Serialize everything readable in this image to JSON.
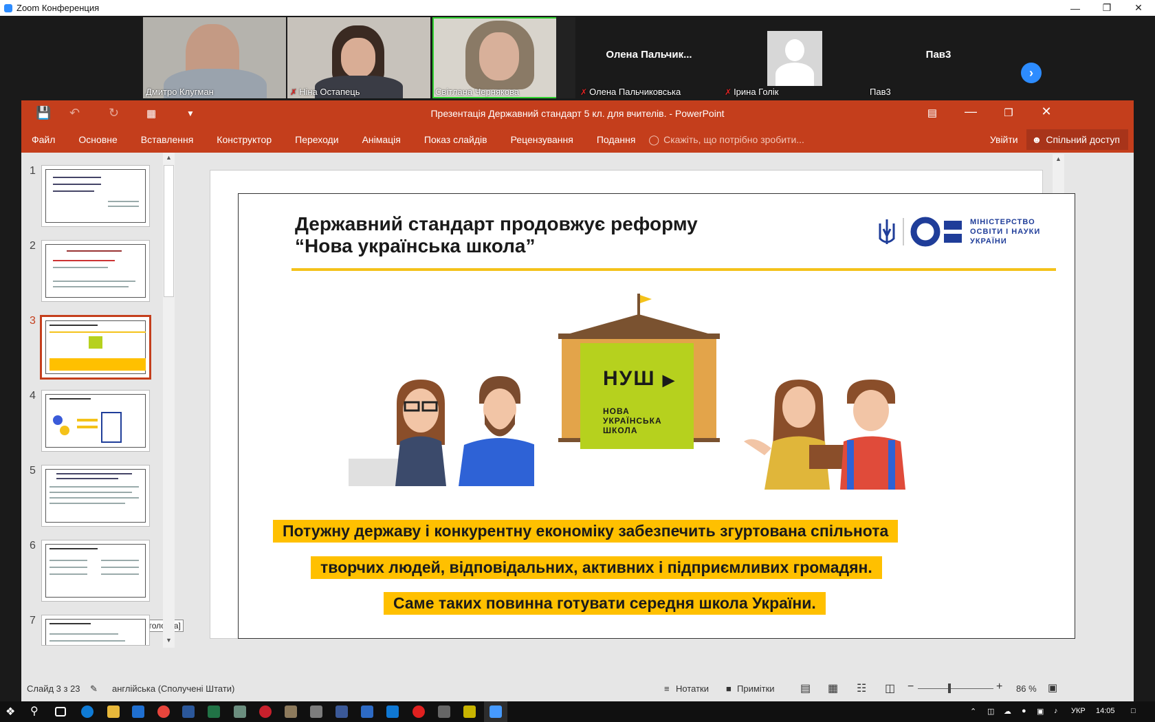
{
  "zoom": {
    "title": "Zoom Конференция",
    "participants": [
      {
        "name": "Дмитро Клугман",
        "muted": false,
        "video": true
      },
      {
        "name": "Ніна Остапець",
        "muted": true,
        "video": true
      },
      {
        "name": "Світлана Чернякова",
        "muted": false,
        "video": true,
        "active": true
      },
      {
        "name": "Олена Пальчиковська",
        "display": "Олена  Пальчик...",
        "muted": true,
        "video": false
      },
      {
        "name": "Ірина Голік",
        "muted": true,
        "video": false
      },
      {
        "name": "Пав3",
        "display": "Пав3",
        "muted": false,
        "video": false
      }
    ]
  },
  "powerpoint": {
    "doc_title": "Презентація Державний стандарт 5 кл. для вчителів. - PowerPoint",
    "tabs": [
      "Файл",
      "Основне",
      "Вставлення",
      "Конструктор",
      "Переходи",
      "Анімація",
      "Показ слайдів",
      "Рецензування",
      "Подання"
    ],
    "tell_me": "Скажіть, що потрібно зробити...",
    "sign_in": "Увійти",
    "share": "Спільний доступ",
    "thumbnails": [
      "1",
      "2",
      "3",
      "4",
      "5",
      "6",
      "7"
    ],
    "selected_slide": 3,
    "tooltip": "[Без заголовка]",
    "slide": {
      "title_line1": "Державний стандарт продовжує реформу",
      "title_line2": "“Нова українська школа”",
      "ministry": [
        "МІНІСТЕРСТВО",
        "ОСВІТИ І НАУКИ",
        "УКРАЇНИ"
      ],
      "nush_logo": "НУШ",
      "nush_sub": [
        "НОВА",
        "УКРАЇНСЬКА",
        "ШКОЛА"
      ],
      "banner1": "Потужну державу і конкурентну економіку забезпечить згуртована спільнота",
      "banner2": "творчих людей, відповідальних, активних і підприємливих громадян.",
      "banner3": "Саме таких повинна готувати середня школа України."
    },
    "status": {
      "slide": "Слайд 3 з 23",
      "language": "англійська (Сполучені Штати)",
      "notes": "Нотатки",
      "comments": "Примітки",
      "zoom": "86 %"
    }
  },
  "taskbar": {
    "lang": "УКР",
    "time": "14:05"
  },
  "colors": {
    "ppt_accent": "#c43e1c",
    "zoom_blue": "#2d8cff",
    "banner_yellow": "#ffc000",
    "nush_green": "#b6d11e"
  }
}
